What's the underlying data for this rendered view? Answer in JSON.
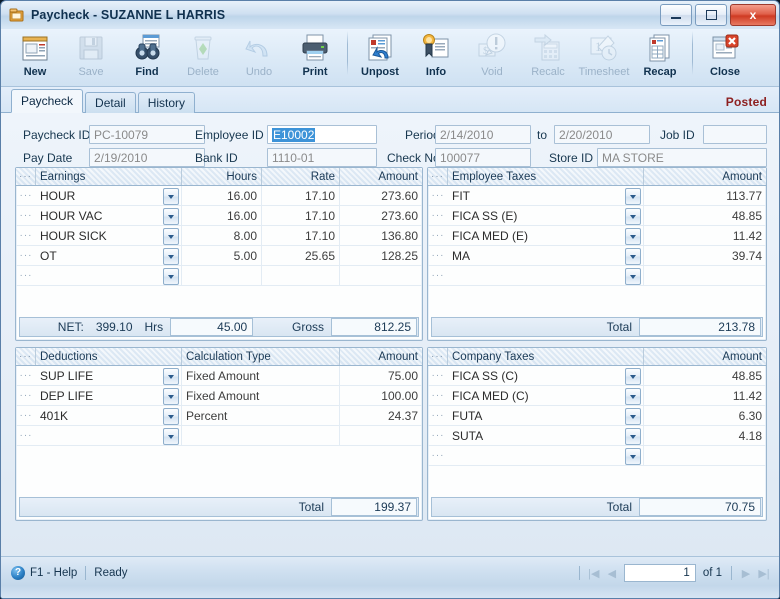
{
  "window": {
    "title": "Paycheck - SUZANNE L HARRIS",
    "icon": "window-app-icon",
    "minimize_label": "Minimize",
    "maximize_label": "Maximize",
    "close_label": "x"
  },
  "toolbar": {
    "items": [
      {
        "label": "New",
        "icon": "new-document-icon",
        "disabled": false
      },
      {
        "label": "Save",
        "icon": "floppy-disk-icon",
        "disabled": true
      },
      {
        "label": "Find",
        "icon": "binoculars-icon",
        "disabled": false
      },
      {
        "label": "Delete",
        "icon": "recycle-bin-icon",
        "disabled": true
      },
      {
        "label": "Undo",
        "icon": "undo-arrow-icon",
        "disabled": true
      },
      {
        "label": "Print",
        "icon": "printer-icon",
        "disabled": false
      },
      {
        "label": "Unpost",
        "icon": "unpost-icon",
        "disabled": false
      },
      {
        "label": "Info",
        "icon": "info-award-icon",
        "disabled": false
      },
      {
        "label": "Void",
        "icon": "void-icon",
        "disabled": true
      },
      {
        "label": "Recalc",
        "icon": "calculator-icon",
        "disabled": true
      },
      {
        "label": "Timesheet",
        "icon": "timesheet-clock-icon",
        "disabled": true
      },
      {
        "label": "Recap",
        "icon": "recap-report-icon",
        "disabled": false
      },
      {
        "label": "Close",
        "icon": "close-window-icon",
        "disabled": false
      }
    ],
    "separators_after": [
      "Print",
      "Recap"
    ]
  },
  "tabs": {
    "items": [
      {
        "label": "Paycheck",
        "active": true
      },
      {
        "label": "Detail",
        "active": false
      },
      {
        "label": "History",
        "active": false
      }
    ],
    "status_label": "Posted"
  },
  "form": {
    "paycheck_id": {
      "label": "Paycheck ID",
      "value": "PC-10079"
    },
    "employee_id": {
      "label": "Employee ID",
      "value": "E10002",
      "selected": true
    },
    "period": {
      "label": "Period",
      "value": "2/14/2010"
    },
    "period_to": {
      "label": "to",
      "value": "2/20/2010"
    },
    "job_id": {
      "label": "Job ID",
      "value": ""
    },
    "pay_date": {
      "label": "Pay Date",
      "value": "2/19/2010"
    },
    "bank_id": {
      "label": "Bank ID",
      "value": "1110-01"
    },
    "check_no": {
      "label": "Check No",
      "value": "100077"
    },
    "store_id": {
      "label": "Store ID",
      "value": "MA STORE"
    }
  },
  "earnings": {
    "title": "Earnings",
    "columns": [
      "Earnings",
      "Hours",
      "Rate",
      "Amount"
    ],
    "rows": [
      {
        "name": "HOUR",
        "hours": "16.00",
        "rate": "17.10",
        "amount": "273.60"
      },
      {
        "name": "HOUR VAC",
        "hours": "16.00",
        "rate": "17.10",
        "amount": "273.60"
      },
      {
        "name": "HOUR SICK",
        "hours": "8.00",
        "rate": "17.10",
        "amount": "136.80"
      },
      {
        "name": "OT",
        "hours": "5.00",
        "rate": "25.65",
        "amount": "128.25"
      },
      {
        "name": "",
        "hours": "",
        "rate": "",
        "amount": ""
      }
    ],
    "footer": {
      "net_label": "NET:",
      "net_value": "399.10",
      "hrs_label": "Hrs",
      "hrs_value": "45.00",
      "gross_label": "Gross",
      "gross_value": "812.25"
    }
  },
  "employee_taxes": {
    "title": "Employee Taxes",
    "columns": [
      "Employee Taxes",
      "Amount"
    ],
    "rows": [
      {
        "name": "FIT",
        "amount": "113.77"
      },
      {
        "name": "FICA SS (E)",
        "amount": "48.85"
      },
      {
        "name": "FICA MED (E)",
        "amount": "11.42"
      },
      {
        "name": "MA",
        "amount": "39.74"
      },
      {
        "name": "",
        "amount": ""
      }
    ],
    "footer": {
      "total_label": "Total",
      "total_value": "213.78"
    }
  },
  "deductions": {
    "title": "Deductions",
    "columns": [
      "Deductions",
      "Calculation Type",
      "Amount"
    ],
    "rows": [
      {
        "name": "SUP LIFE",
        "calc": "Fixed Amount",
        "amount": "75.00"
      },
      {
        "name": "DEP LIFE",
        "calc": "Fixed Amount",
        "amount": "100.00"
      },
      {
        "name": "401K",
        "calc": "Percent",
        "amount": "24.37"
      },
      {
        "name": "",
        "calc": "",
        "amount": ""
      }
    ],
    "footer": {
      "total_label": "Total",
      "total_value": "199.37"
    }
  },
  "company_taxes": {
    "title": "Company Taxes",
    "columns": [
      "Company Taxes",
      "Amount"
    ],
    "rows": [
      {
        "name": "FICA SS (C)",
        "amount": "48.85"
      },
      {
        "name": "FICA MED (C)",
        "amount": "11.42"
      },
      {
        "name": "FUTA",
        "amount": "6.30"
      },
      {
        "name": "SUTA",
        "amount": "4.18"
      },
      {
        "name": "",
        "amount": ""
      }
    ],
    "footer": {
      "total_label": "Total",
      "total_value": "70.75"
    }
  },
  "statusbar": {
    "help_icon": "help-question-icon",
    "help_label": "F1 - Help",
    "ready_label": "Ready",
    "nav": {
      "first_label": "|◀",
      "prev_label": "◀",
      "page_value": "1",
      "of_label": "of 1",
      "next_label": "▶",
      "last_label": "▶|"
    }
  },
  "row_dots": "···",
  "colors": {
    "accent": "#2a7fc4",
    "posted": "#8d2020",
    "selection": "#3d93d8",
    "panel_border": "#9ab6cf"
  }
}
